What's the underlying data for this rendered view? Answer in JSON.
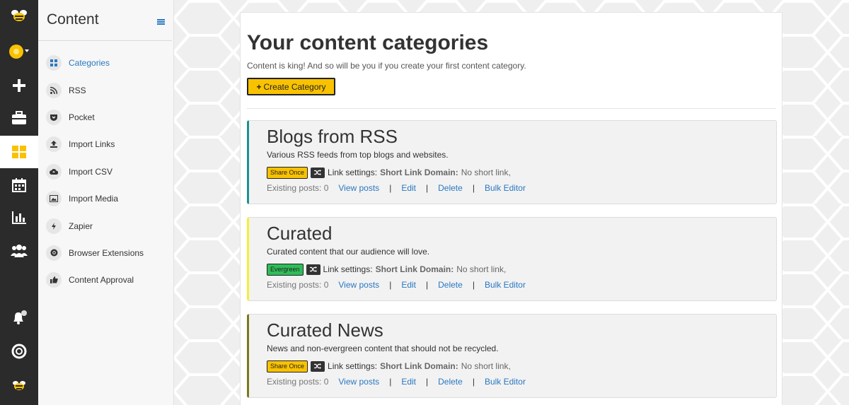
{
  "colors": {
    "accent": "#f9c200",
    "link": "#2a78c2",
    "rail": "#2b2b2b",
    "evergreen": "#2ebd59"
  },
  "rail": {
    "items": [
      {
        "name": "logo-bee-icon"
      },
      {
        "name": "account-avatar-icon"
      },
      {
        "name": "add-icon"
      },
      {
        "name": "briefcase-icon"
      },
      {
        "name": "content-grid-icon"
      },
      {
        "name": "calendar-icon"
      },
      {
        "name": "analytics-icon"
      },
      {
        "name": "team-icon"
      },
      {
        "name": "notifications-icon"
      },
      {
        "name": "help-lifebuoy-icon"
      },
      {
        "name": "bee-small-icon"
      }
    ]
  },
  "sidebar": {
    "title": "Content",
    "items": [
      {
        "label": "Categories",
        "icon": "grid-icon",
        "active": true
      },
      {
        "label": "RSS",
        "icon": "rss-icon"
      },
      {
        "label": "Pocket",
        "icon": "pocket-icon"
      },
      {
        "label": "Import Links",
        "icon": "upload-icon"
      },
      {
        "label": "Import CSV",
        "icon": "cloud-upload-icon"
      },
      {
        "label": "Import Media",
        "icon": "image-icon"
      },
      {
        "label": "Zapier",
        "icon": "bolt-icon"
      },
      {
        "label": "Browser Extensions",
        "icon": "chrome-icon"
      },
      {
        "label": "Content Approval",
        "icon": "thumbs-up-icon"
      }
    ]
  },
  "main": {
    "title": "Your content categories",
    "subtitle": "Content is king! And so will be you if you create your first content category.",
    "create_label": "Create Category",
    "categories": [
      {
        "title": "Blogs from RSS",
        "description": "Various RSS feeds from top blogs and websites.",
        "badge": "Share Once",
        "border_color": "#1f8f8f",
        "link_settings": "Link settings:",
        "short_link_label": "Short Link Domain:",
        "short_link_value": "No short link,",
        "existing": "Existing posts: 0",
        "actions": {
          "view": "View posts",
          "edit": "Edit",
          "delete": "Delete",
          "bulk": "Bulk Editor"
        }
      },
      {
        "title": "Curated",
        "description": "Curated content that our audience will love.",
        "badge": "Evergreen",
        "border_color": "#f3ef3a",
        "link_settings": "Link settings:",
        "short_link_label": "Short Link Domain:",
        "short_link_value": "No short link,",
        "existing": "Existing posts: 0",
        "actions": {
          "view": "View posts",
          "edit": "Edit",
          "delete": "Delete",
          "bulk": "Bulk Editor"
        }
      },
      {
        "title": "Curated News",
        "description": "News and non-evergreen content that should not be recycled.",
        "badge": "Share Once",
        "border_color": "#7a7a1a",
        "link_settings": "Link settings:",
        "short_link_label": "Short Link Domain:",
        "short_link_value": "No short link,",
        "existing": "Existing posts: 0",
        "actions": {
          "view": "View posts",
          "edit": "Edit",
          "delete": "Delete",
          "bulk": "Bulk Editor"
        }
      }
    ]
  }
}
